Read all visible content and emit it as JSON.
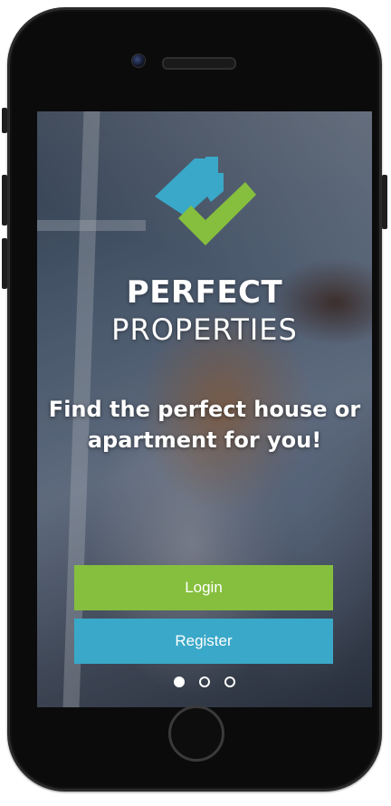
{
  "brand": {
    "line1": "PERFECT",
    "line2": "PROPERTIES"
  },
  "tagline": "Find the perfect house or apartment for you!",
  "actions": {
    "login_label": "Login",
    "register_label": "Register"
  },
  "pager": {
    "total": 3,
    "active_index": 0
  },
  "colors": {
    "login_button": "#86bf3d",
    "register_button": "#3aa8c8",
    "logo_house": "#3aa8c8",
    "logo_check": "#86bf3d",
    "text": "#ffffff"
  },
  "icons": {
    "logo": "house-check-logo"
  }
}
